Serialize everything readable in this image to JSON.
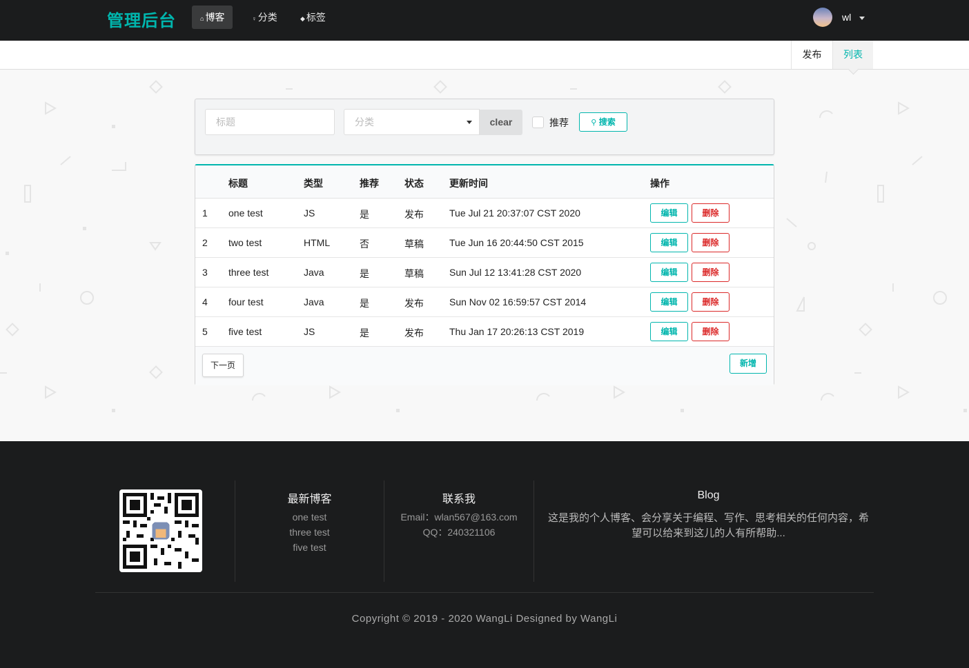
{
  "nav": {
    "brand": "管理后台",
    "items": [
      {
        "label": "博客",
        "icon": "home-icon",
        "active": true
      },
      {
        "label": "分类",
        "icon": "idea-icon",
        "active": false
      },
      {
        "label": "标签",
        "icon": "tag-icon",
        "active": false
      }
    ],
    "user": {
      "name": "wl"
    }
  },
  "submenu": {
    "publish": "发布",
    "list": "列表",
    "active": "list"
  },
  "search": {
    "title_placeholder": "标题",
    "category_placeholder": "分类",
    "clear_label": "clear",
    "recommend_label": "推荐",
    "search_label": "搜索"
  },
  "table": {
    "headers": [
      "",
      "标题",
      "类型",
      "推荐",
      "状态",
      "更新时间",
      "操作"
    ],
    "rows": [
      {
        "no": "1",
        "title": "one test",
        "type": "JS",
        "recommend": "是",
        "status": "发布",
        "updated": "Tue Jul 21 20:37:07 CST 2020"
      },
      {
        "no": "2",
        "title": "two test",
        "type": "HTML",
        "recommend": "否",
        "status": "草稿",
        "updated": "Tue Jun 16 20:44:50 CST 2015"
      },
      {
        "no": "3",
        "title": "three test",
        "type": "Java",
        "recommend": "是",
        "status": "草稿",
        "updated": "Sun Jul 12 13:41:28 CST 2020"
      },
      {
        "no": "4",
        "title": "four test",
        "type": "Java",
        "recommend": "是",
        "status": "发布",
        "updated": "Sun Nov 02 16:59:57 CST 2014"
      },
      {
        "no": "5",
        "title": "five test",
        "type": "JS",
        "recommend": "是",
        "status": "发布",
        "updated": "Thu Jan 17 20:26:13 CST 2019"
      }
    ],
    "edit_label": "编辑",
    "delete_label": "删除",
    "next_label": "下一页",
    "new_label": "新增"
  },
  "footer": {
    "latest_title": "最新博客",
    "latest_items": [
      "one test",
      "three test",
      "five test"
    ],
    "contact_title": "联系我",
    "email": "Email：wlan567@163.com",
    "qq": "QQ：240321106",
    "blog_title": "Blog",
    "blog_desc": "这是我的个人博客、会分享关于编程、写作、思考相关的任何内容，希望可以给来到这儿的人有所帮助...",
    "copyright": "Copyright © 2019 - 2020 WangLi Designed by WangLi"
  },
  "colors": {
    "accent": "#00b5ad",
    "danger": "#db2828",
    "dark": "#1b1c1d"
  }
}
